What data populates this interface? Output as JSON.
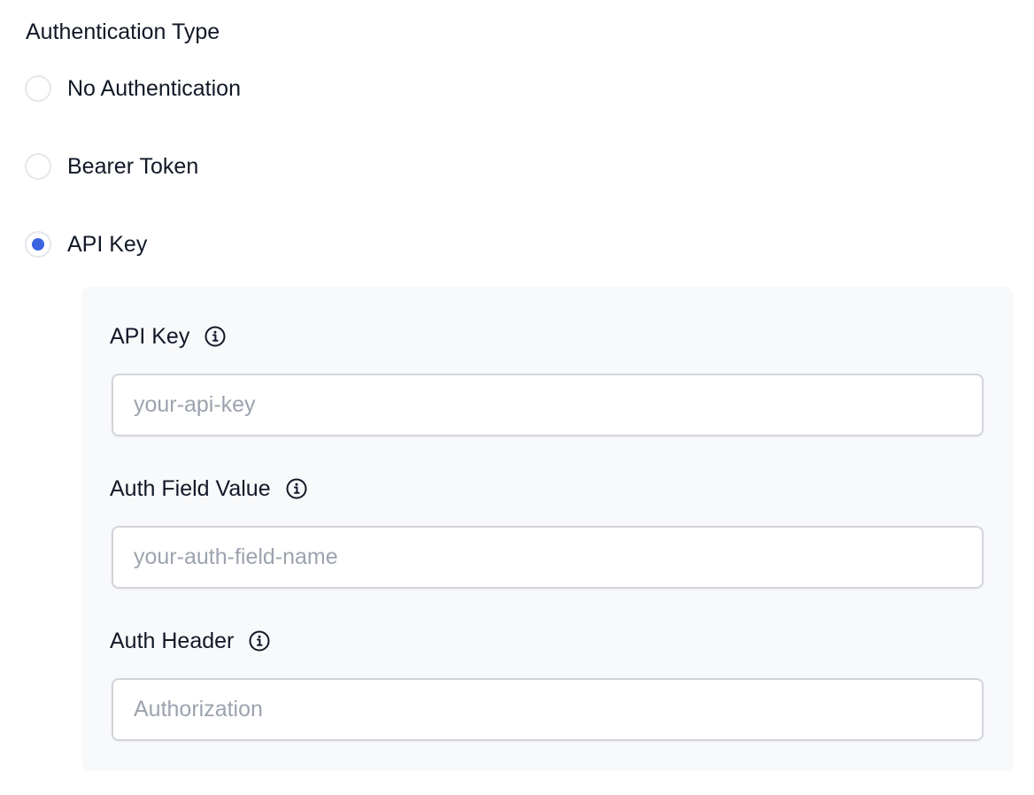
{
  "auth": {
    "title": "Authentication Type",
    "options": [
      {
        "label": "No Authentication",
        "selected": false
      },
      {
        "label": "Bearer Token",
        "selected": false
      },
      {
        "label": "API Key",
        "selected": true
      }
    ]
  },
  "api_key_panel": {
    "fields": [
      {
        "label": "API Key",
        "placeholder": "your-api-key",
        "value": "",
        "icon": "info-icon"
      },
      {
        "label": "Auth Field Value",
        "placeholder": "your-auth-field-name",
        "value": "",
        "icon": "info-icon"
      },
      {
        "label": "Auth Header",
        "placeholder": "Authorization",
        "value": "",
        "icon": "info-icon"
      }
    ]
  },
  "colors": {
    "accent": "#3b63e0",
    "panel_bg": "#f8f9fb",
    "border": "#d1d5db",
    "placeholder": "#9ca3af",
    "text": "#111827"
  }
}
